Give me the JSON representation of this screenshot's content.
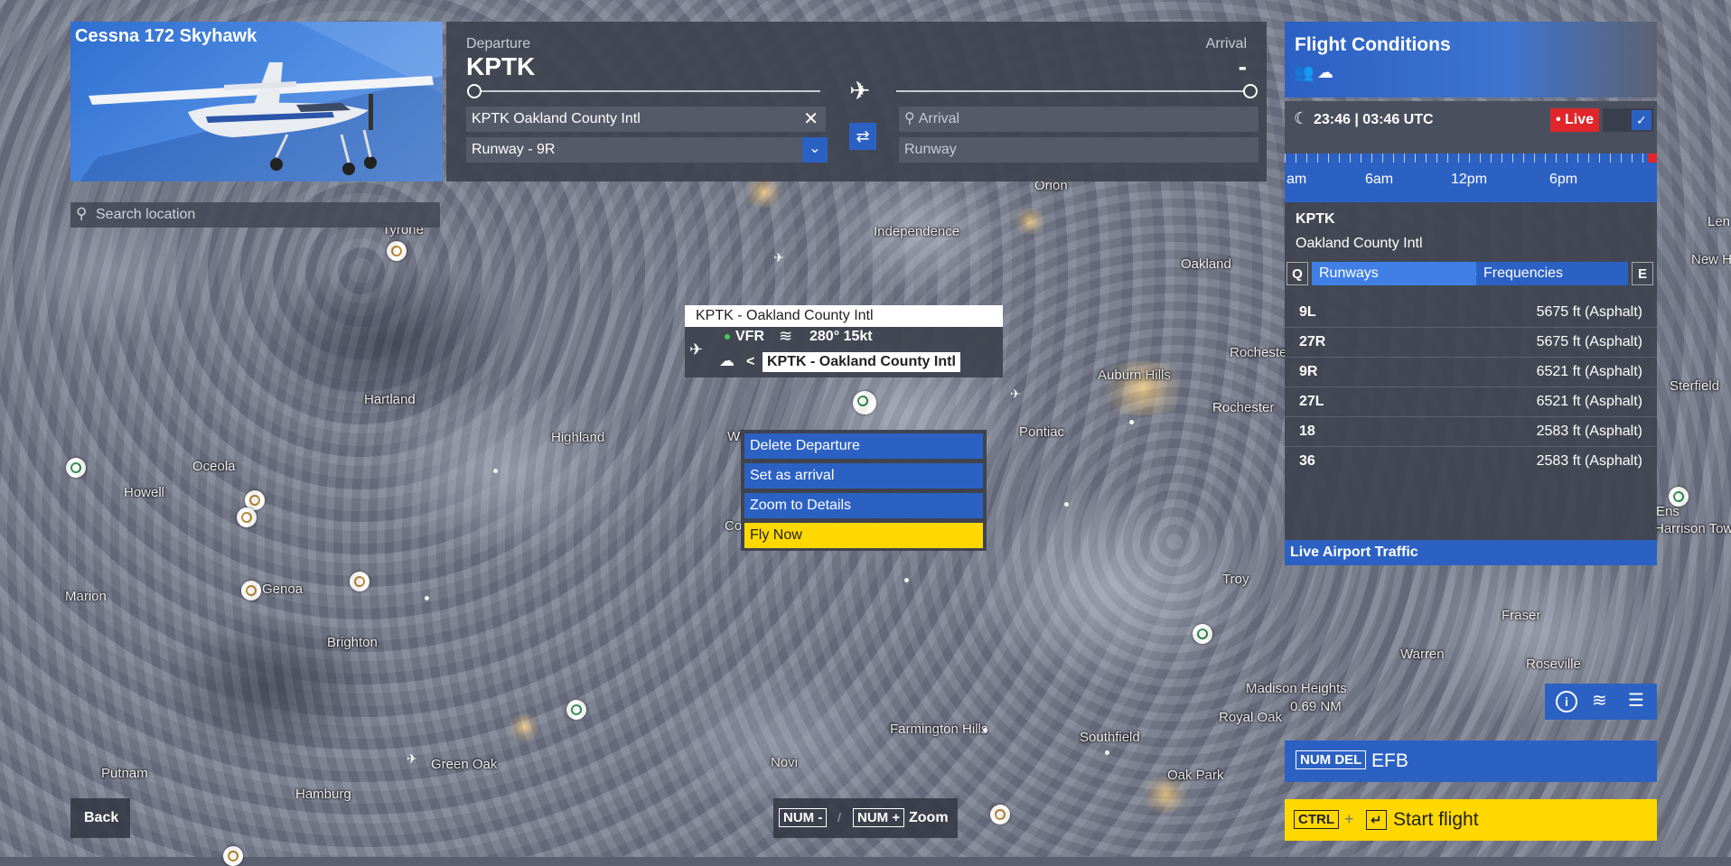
{
  "aircraft": {
    "title": "Cessna 172 Skyhawk"
  },
  "search": {
    "placeholder": "Search location"
  },
  "route": {
    "departure_label": "Departure",
    "departure_code": "KPTK",
    "arrival_label": "Arrival",
    "arrival_code": "-",
    "departure_field": "KPTK Oakland County Intl",
    "departure_runway": "Runway - 9R",
    "arrival_field_placeholder": "Arrival",
    "arrival_runway": "Runway"
  },
  "conditions": {
    "title": "Flight Conditions",
    "time": "23:46 | 03:46 UTC",
    "live_label": "• Live",
    "axis": [
      "am",
      "6am",
      "12pm",
      "6pm"
    ]
  },
  "airport_info": {
    "code": "KPTK",
    "name": "Oakland County Intl",
    "tab_q": "Q",
    "tab_runways": "Runways",
    "tab_frequencies": "Frequencies",
    "tab_e": "E",
    "runways": [
      {
        "id": "9L",
        "info": "5675 ft (Asphalt)"
      },
      {
        "id": "27R",
        "info": "5675 ft (Asphalt)"
      },
      {
        "id": "9R",
        "info": "6521 ft (Asphalt)"
      },
      {
        "id": "27L",
        "info": "6521 ft (Asphalt)"
      },
      {
        "id": "18",
        "info": "2583 ft (Asphalt)"
      },
      {
        "id": "36",
        "info": "2583 ft (Asphalt)"
      }
    ],
    "traffic_label": "Live Airport Traffic"
  },
  "efb": {
    "key": "NUM DEL",
    "label": "EFB"
  },
  "start": {
    "key": "CTRL",
    "plus": "+",
    "enter": "↵",
    "label": "Start flight"
  },
  "back": {
    "label": "Back"
  },
  "zoom": {
    "minus_key": "NUM -",
    "sep": "/",
    "plus_key": "NUM +",
    "label": "Zoom"
  },
  "popup": {
    "title": "KPTK - Oakland County Intl",
    "rules": "VFR",
    "wind": "280° 15kt",
    "cloud_prefix": "<",
    "label": "KPTK - Oakland County Intl"
  },
  "context_menu": [
    "Delete Departure",
    "Set as arrival",
    "Zoom to Details",
    "Fly Now"
  ],
  "scale": "0.69 NM",
  "cities": [
    "Tyrone",
    "Independence",
    "Orion",
    "Oakland",
    "Hartland",
    "Highland",
    "Auburn Hills",
    "Rochester",
    "Rochester",
    "Pontiac",
    "Oceola",
    "Howell",
    "Marion",
    "Brighton",
    "Troy",
    "Fraser",
    "Warren",
    "Roseville",
    "Madison Heights",
    "Royal Oak",
    "Farmington Hills",
    "Southfield",
    "Oak Park",
    "Novi",
    "Green Oak",
    "Putnam",
    "Hamburg",
    "Sterfield",
    "Ens",
    "Harrison Tow",
    "Len",
    "New H",
    "Genoa",
    "Wl",
    "Co"
  ]
}
